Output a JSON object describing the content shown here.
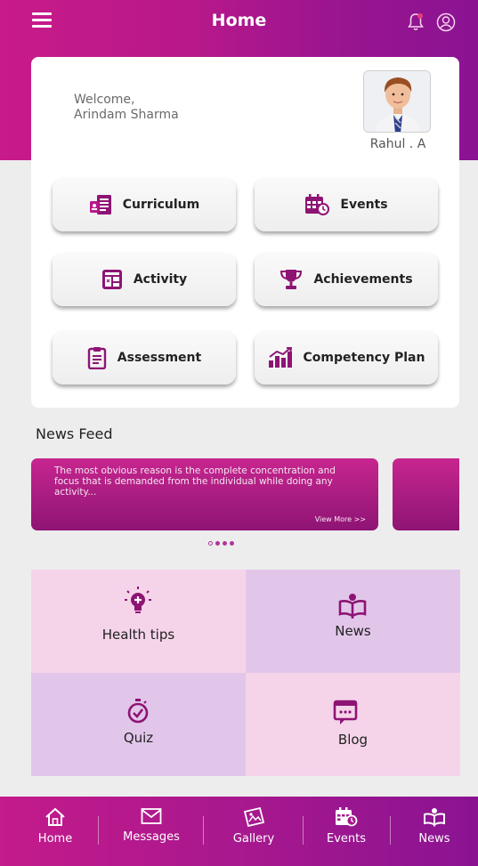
{
  "header": {
    "title": "Home"
  },
  "welcome": {
    "greeting": "Welcome,",
    "parent_name": "Arindam Sharma"
  },
  "student": {
    "name": "Rahul . A"
  },
  "tiles": [
    {
      "label": "Curriculum",
      "icon": "curriculum-icon"
    },
    {
      "label": "Events",
      "icon": "calendar-icon"
    },
    {
      "label": "Activity",
      "icon": "activity-icon"
    },
    {
      "label": "Achievements",
      "icon": "trophy-icon"
    },
    {
      "label": "Assessment",
      "icon": "clipboard-icon"
    },
    {
      "label": "Competency Plan",
      "icon": "chart-icon"
    }
  ],
  "news_feed": {
    "title": "News Feed",
    "cards": [
      {
        "text": "The most obvious reason is the complete concentration and focus that is demanded from the individual while doing any activity...",
        "link": "View More >>"
      }
    ]
  },
  "features": [
    {
      "label": "Health tips",
      "icon": "lightbulb-icon",
      "bg": "#f5d4ea"
    },
    {
      "label": "News",
      "icon": "news-icon",
      "bg": "#e2c6ea"
    },
    {
      "label": "Quiz",
      "icon": "stopwatch-icon",
      "bg": "#e2c6ea"
    },
    {
      "label": "Blog",
      "icon": "chat-icon",
      "bg": "#f5d4ea"
    }
  ],
  "bottom_nav": [
    {
      "label": "Home",
      "icon": "home-icon"
    },
    {
      "label": "Messages",
      "icon": "envelope-icon"
    },
    {
      "label": "Gallery",
      "icon": "gallery-icon"
    },
    {
      "label": "Events",
      "icon": "calendar-icon"
    },
    {
      "label": "News",
      "icon": "news-icon"
    }
  ],
  "colors": {
    "primary": "#b8188a",
    "accent_dark": "#8a1392",
    "icon": "#8e1474"
  }
}
